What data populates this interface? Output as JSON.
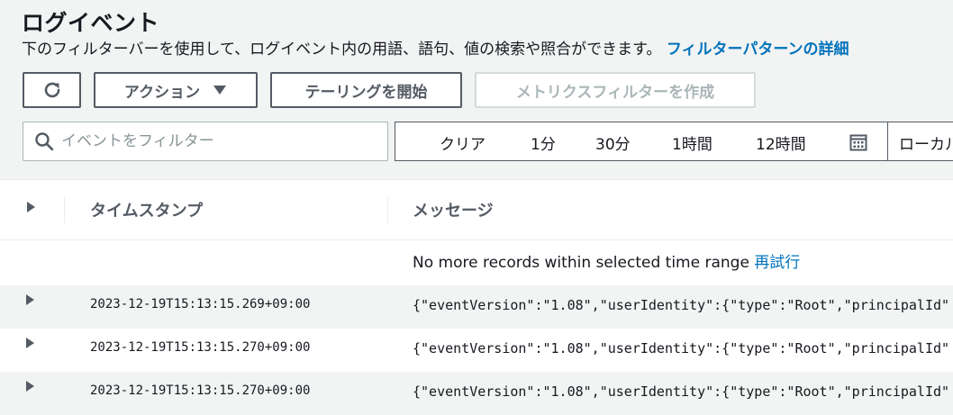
{
  "header": {
    "title": "ログイベント",
    "description": "下のフィルターバーを使用して、ログイベント内の用語、語句、値の検索や照合ができます。",
    "link": "フィルターパターンの詳細"
  },
  "toolbar": {
    "actions_label": "アクション",
    "tail_label": "テーリングを開始",
    "metric_filter_label": "メトリクスフィルターを作成"
  },
  "filter": {
    "placeholder": "イベントをフィルター"
  },
  "time_range": {
    "clear": "クリア",
    "opt_1m": "1分",
    "opt_30m": "30分",
    "opt_1h": "1時間",
    "opt_12h": "12時間",
    "timezone": "ローカル"
  },
  "table": {
    "col_timestamp": "タイムスタンプ",
    "col_message": "メッセージ",
    "no_more_text": "No more records within selected time range",
    "retry_label": "再試行",
    "rows": [
      {
        "timestamp": "2023-12-19T15:13:15.269+09:00",
        "message": "{\"eventVersion\":\"1.08\",\"userIdentity\":{\"type\":\"Root\",\"principalId\""
      },
      {
        "timestamp": "2023-12-19T15:13:15.270+09:00",
        "message": "{\"eventVersion\":\"1.08\",\"userIdentity\":{\"type\":\"Root\",\"principalId\""
      },
      {
        "timestamp": "2023-12-19T15:13:15.270+09:00",
        "message": "{\"eventVersion\":\"1.08\",\"userIdentity\":{\"type\":\"Root\",\"principalId\""
      }
    ]
  },
  "icons": {
    "refresh": "refresh-icon",
    "dropdown": "caret-down-icon",
    "search": "search-icon",
    "calendar": "calendar-icon",
    "expand": "caret-right-icon"
  },
  "colors": {
    "link": "#0073bb",
    "border": "#545b64",
    "alt_row": "#f2f3f3"
  }
}
